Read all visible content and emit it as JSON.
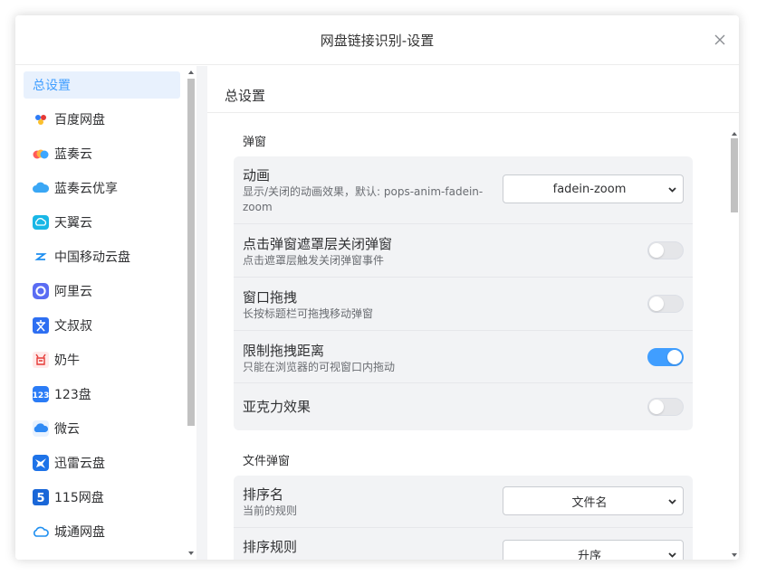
{
  "dialog": {
    "title": "网盘链接识别-设置"
  },
  "sidebar": {
    "items": [
      {
        "label": "总设置",
        "icon": "none",
        "active": true
      },
      {
        "label": "百度网盘",
        "icon": "baidu-icon"
      },
      {
        "label": "蓝奏云",
        "icon": "lanzou-icon"
      },
      {
        "label": "蓝奏云优享",
        "icon": "lanzou-youxiang-icon"
      },
      {
        "label": "天翼云",
        "icon": "tianyi-icon"
      },
      {
        "label": "中国移动云盘",
        "icon": "china-mobile-icon"
      },
      {
        "label": "阿里云",
        "icon": "aliyun-icon"
      },
      {
        "label": "文叔叔",
        "icon": "wenshushu-icon"
      },
      {
        "label": "奶牛",
        "icon": "nainiu-icon"
      },
      {
        "label": "123盘",
        "icon": "pan123-icon"
      },
      {
        "label": "微云",
        "icon": "weiyun-icon"
      },
      {
        "label": "迅雷云盘",
        "icon": "xunlei-icon"
      },
      {
        "label": "115网盘",
        "icon": "pan115-icon"
      },
      {
        "label": "城通网盘",
        "icon": "chengtong-icon"
      }
    ]
  },
  "main": {
    "title": "总设置",
    "sections": [
      {
        "title": "弹窗",
        "rows": [
          {
            "label": "动画",
            "desc": "显示/关闭的动画效果，默认: pops-anim-fadein-zoom",
            "control": "select",
            "value": "fadein-zoom"
          },
          {
            "label": "点击弹窗遮罩层关闭弹窗",
            "desc": "点击遮罩层触发关闭弹窗事件",
            "control": "toggle",
            "on": false
          },
          {
            "label": "窗口拖拽",
            "desc": "长按标题栏可拖拽移动弹窗",
            "control": "toggle",
            "on": false
          },
          {
            "label": "限制拖拽距离",
            "desc": "只能在浏览器的可视窗口内拖动",
            "control": "toggle",
            "on": true
          },
          {
            "label": "亚克力效果",
            "desc": "",
            "control": "toggle",
            "on": false
          }
        ]
      },
      {
        "title": "文件弹窗",
        "rows": [
          {
            "label": "排序名",
            "desc": "当前的规则",
            "control": "select",
            "value": "文件名"
          },
          {
            "label": "排序规则",
            "desc": "",
            "control": "select",
            "value": "升序"
          }
        ]
      }
    ]
  },
  "colors": {
    "accent": "#409eff",
    "group_bg": "#f2f3f5",
    "active_bg": "#e8f1fd"
  }
}
